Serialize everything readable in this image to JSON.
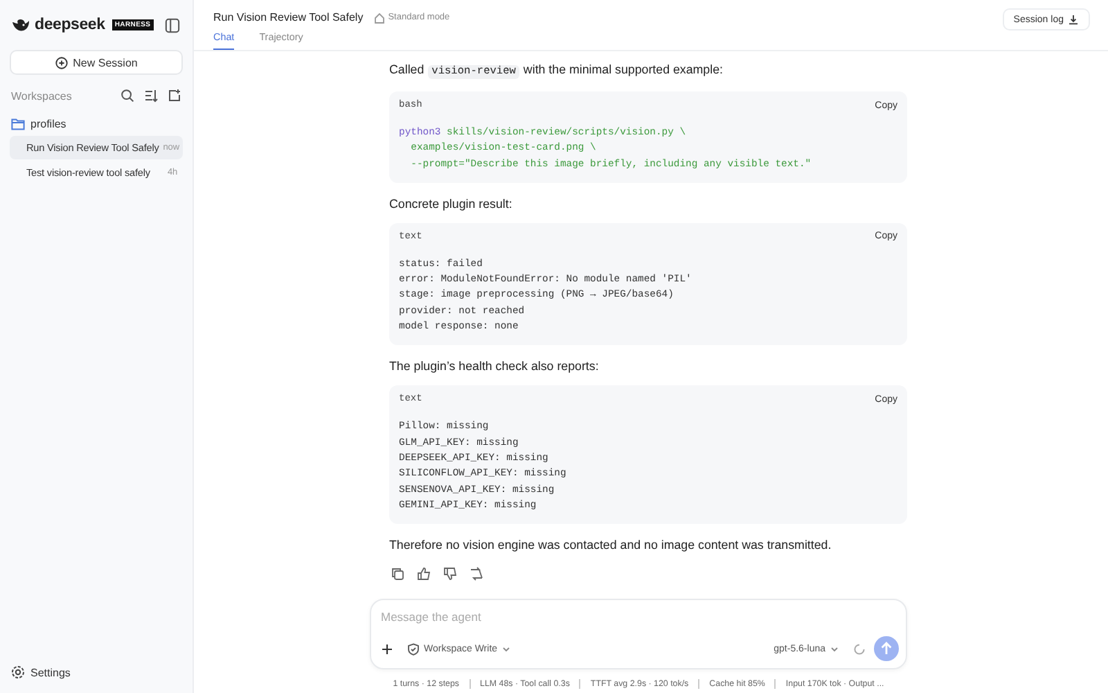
{
  "sidebar": {
    "brand": "deepseek",
    "brand_badge": "HARNESS",
    "new_session": "New Session",
    "section_title": "Workspaces",
    "folder": {
      "label": "profiles",
      "children": [
        {
          "label": "Run Vision Review Tool Safely",
          "time": "now",
          "selected": true
        },
        {
          "label": "Test vision-review tool safely",
          "time": "4h",
          "selected": false
        }
      ]
    },
    "settings": "Settings"
  },
  "header": {
    "title": "Run Vision Review Tool Safely",
    "mode": "Standard mode",
    "session_log": "Session log",
    "tabs": [
      {
        "label": "Chat",
        "selected": true
      },
      {
        "label": "Trajectory",
        "selected": false
      }
    ]
  },
  "messages": [
    {
      "kind": "paragraph",
      "parts": [
        {
          "text": "Called ",
          "code": false
        },
        {
          "text": "vision-review",
          "code": true
        },
        {
          "text": " with the minimal supported example:",
          "code": false
        }
      ]
    },
    {
      "kind": "code",
      "language": "bash",
      "copy": "Copy",
      "lines": [
        [
          {
            "text": "python3",
            "kind": "keyword"
          },
          {
            "text": " skills/vision-review/scripts/vision.py \\",
            "kind": "string"
          }
        ],
        [
          {
            "text": "  examples/vision-test-card.png \\",
            "kind": "string"
          }
        ],
        [
          {
            "text": "  --prompt=\"Describe this image briefly, including any visible text.\"",
            "kind": "string"
          }
        ]
      ]
    },
    {
      "kind": "paragraph",
      "parts": [
        {
          "text": "Concrete plugin result:",
          "code": false
        }
      ]
    },
    {
      "kind": "code",
      "language": "text",
      "copy": "Copy",
      "lines": [
        [
          {
            "text": "status: failed",
            "kind": "plain"
          }
        ],
        [
          {
            "text": "error: ModuleNotFoundError: No module named 'PIL'",
            "kind": "plain"
          }
        ],
        [
          {
            "text": "stage: image preprocessing (PNG → JPEG/base64)",
            "kind": "plain"
          }
        ],
        [
          {
            "text": "provider: not reached",
            "kind": "plain"
          }
        ],
        [
          {
            "text": "model response: none",
            "kind": "plain"
          }
        ]
      ]
    },
    {
      "kind": "paragraph",
      "parts": [
        {
          "text": "The plugin’s health check also reports:",
          "code": false
        }
      ]
    },
    {
      "kind": "code",
      "language": "text",
      "copy": "Copy",
      "lines": [
        [
          {
            "text": "Pillow: missing",
            "kind": "plain"
          }
        ],
        [
          {
            "text": "GLM_API_KEY: missing",
            "kind": "plain"
          }
        ],
        [
          {
            "text": "DEEPSEEK_API_KEY: missing",
            "kind": "plain"
          }
        ],
        [
          {
            "text": "SILICONFLOW_API_KEY: missing",
            "kind": "plain"
          }
        ],
        [
          {
            "text": "SENSENOVA_API_KEY: missing",
            "kind": "plain"
          }
        ],
        [
          {
            "text": "GEMINI_API_KEY: missing",
            "kind": "plain"
          }
        ]
      ]
    },
    {
      "kind": "paragraph",
      "parts": [
        {
          "text": "Therefore no vision engine was contacted and no image content was transmitted.",
          "code": false
        }
      ]
    }
  ],
  "composer": {
    "placeholder": "Message the agent",
    "permission": "Workspace Write",
    "model": "gpt-5.6-luna"
  },
  "status_bar": [
    "1 turns · 12 steps",
    "LLM 48s · Tool call 0.3s",
    "TTFT avg 2.9s · 120 tok/s",
    "Cache hit 85%",
    "Input 170K tok · Output ..."
  ]
}
